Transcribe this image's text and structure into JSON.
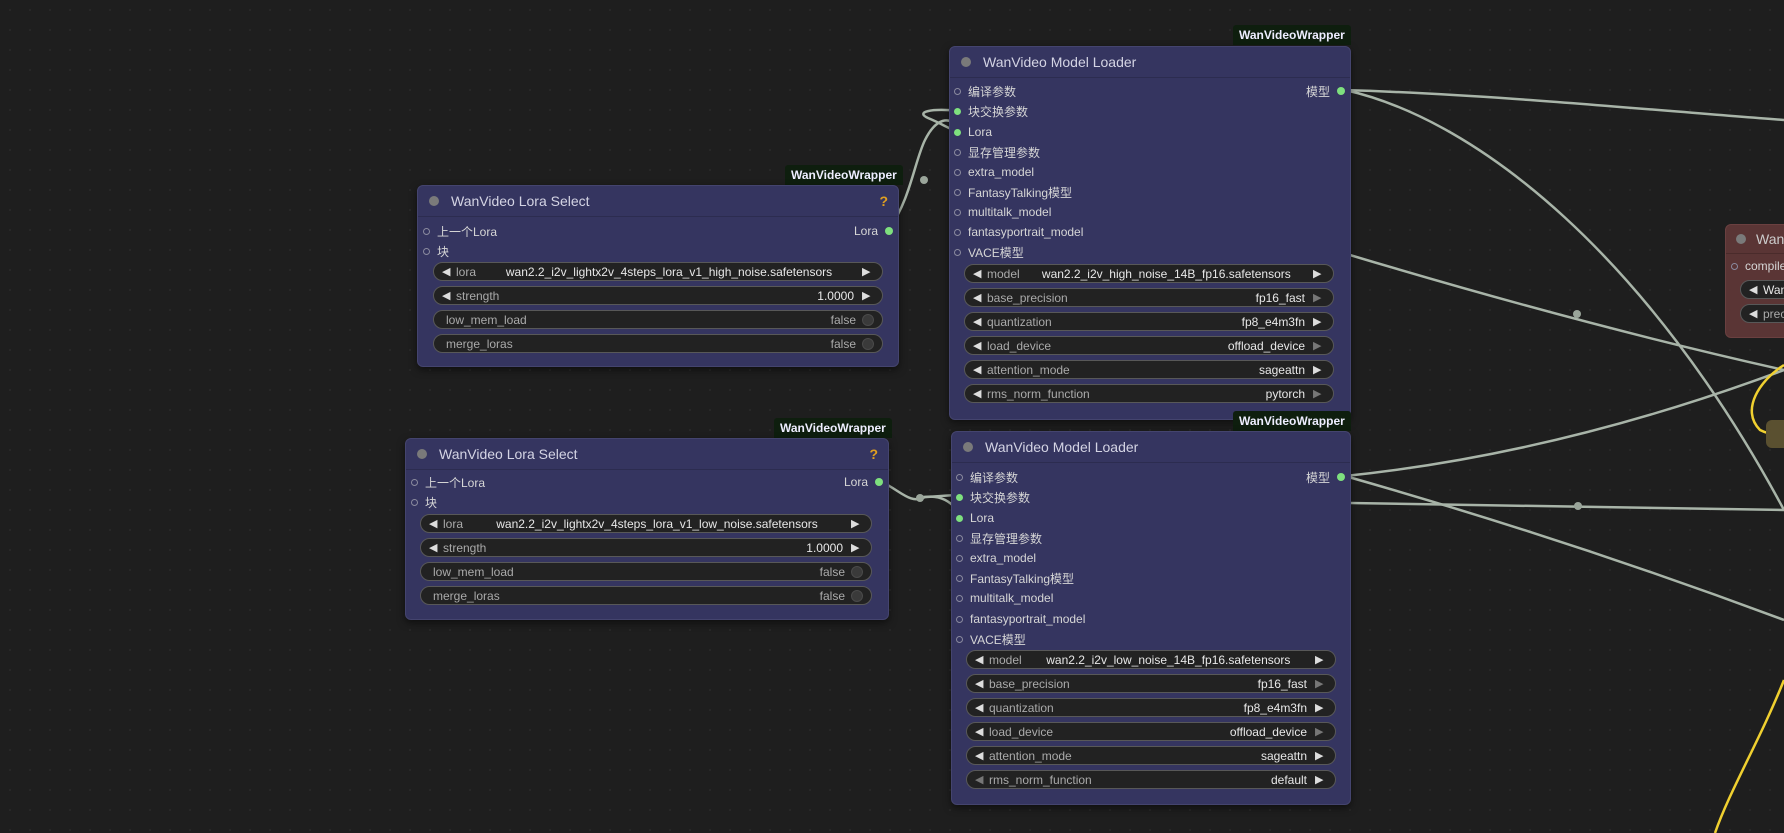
{
  "badge": "WanVideoWrapper",
  "lora_select_title": "WanVideo Lora Select",
  "model_loader_title": "WanVideo Model Loader",
  "help_glyph": "?",
  "lora_inputs": [
    "上一个Lora",
    "块"
  ],
  "lora_output": "Lora",
  "model_output": "模型",
  "model_inputs": [
    "编译参数",
    "块交换参数",
    "Lora",
    "显存管理参数",
    "extra_model",
    "FantasyTalking模型",
    "multitalk_model",
    "fantasyportrait_model",
    "VACE模型"
  ],
  "lora_nodes": [
    {
      "lora_label": "lora",
      "lora_value": "wan2.2_i2v_lightx2v_4steps_lora_v1_high_noise.safetensors",
      "strength_label": "strength",
      "strength_value": "1.0000",
      "low_mem_label": "low_mem_load",
      "low_mem_value": "false",
      "merge_label": "merge_loras",
      "merge_value": "false"
    },
    {
      "lora_label": "lora",
      "lora_value": "wan2.2_i2v_lightx2v_4steps_lora_v1_low_noise.safetensors",
      "strength_label": "strength",
      "strength_value": "1.0000",
      "low_mem_label": "low_mem_load",
      "low_mem_value": "false",
      "merge_label": "merge_loras",
      "merge_value": "false"
    }
  ],
  "model_nodes": [
    {
      "widgets": [
        {
          "label": "model",
          "value": "wan2.2_i2v_high_noise_14B_fp16.safetensors"
        },
        {
          "label": "base_precision",
          "value": "fp16_fast"
        },
        {
          "label": "quantization",
          "value": "fp8_e4m3fn"
        },
        {
          "label": "load_device",
          "value": "offload_device"
        },
        {
          "label": "attention_mode",
          "value": "sageattn"
        },
        {
          "label": "rms_norm_function",
          "value": "pytorch"
        }
      ]
    },
    {
      "widgets": [
        {
          "label": "model",
          "value": "wan2.2_i2v_low_noise_14B_fp16.safetensors"
        },
        {
          "label": "base_precision",
          "value": "fp16_fast"
        },
        {
          "label": "quantization",
          "value": "fp8_e4m3fn"
        },
        {
          "label": "load_device",
          "value": "offload_device"
        },
        {
          "label": "attention_mode",
          "value": "sageattn"
        },
        {
          "label": "rms_norm_function",
          "value": "default"
        }
      ]
    }
  ],
  "partial_node": {
    "title": "Wan",
    "input": "compile",
    "widget1": "Wan",
    "widget2": "prec"
  },
  "colors": {
    "canvas": "#1e1e1e",
    "node_body": "#353560",
    "wire": "#a8b4a8",
    "active_socket": "#7ee07e",
    "yellow_wire": "#f0d030",
    "partial_node": "#5a3535"
  }
}
